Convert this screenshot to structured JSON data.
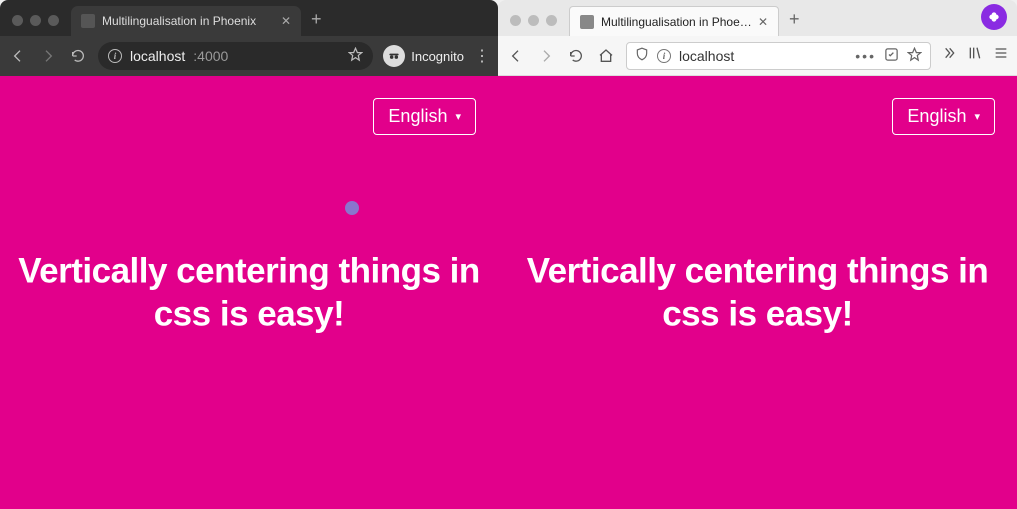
{
  "chrome": {
    "tab_title": "Multilingualisation in Phoenix",
    "url_host": "localhost",
    "url_port": ":4000",
    "incognito_label": "Incognito"
  },
  "firefox": {
    "tab_title": "Multilingualisation in Phoenix",
    "url_text": "localhost"
  },
  "content": {
    "language_label": "English",
    "language_caret": "▾",
    "headline": "Vertically centering things in css is easy!"
  }
}
